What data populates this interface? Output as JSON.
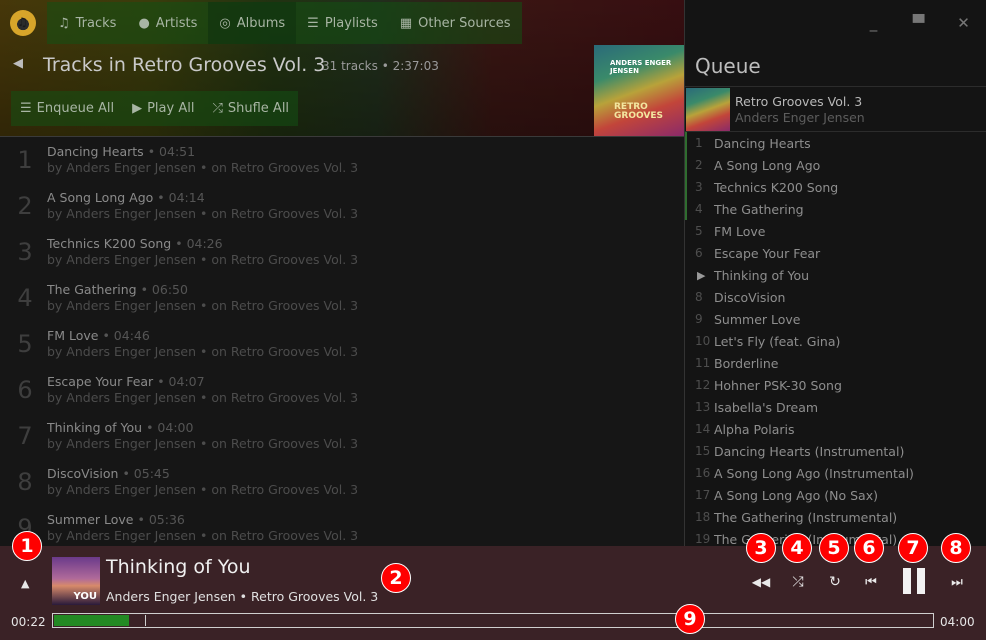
{
  "nav": {
    "tabs": [
      {
        "label": "Tracks",
        "icon": "note-icon"
      },
      {
        "label": "Artists",
        "icon": "person-icon"
      },
      {
        "label": "Albums",
        "icon": "album-icon"
      },
      {
        "label": "Playlists",
        "icon": "list-icon"
      },
      {
        "label": "Other Sources",
        "icon": "grid-icon"
      }
    ],
    "active_tab": "Albums"
  },
  "album": {
    "title": "Tracks in Retro Grooves Vol. 3",
    "meta": "31 tracks • 2:37:03",
    "art_text": "ANDERS ENGER JENSEN",
    "art_logo": "RETRO GROOVES"
  },
  "actions": {
    "enqueue_all": "Enqueue All",
    "play_all": "Play All",
    "shuffle_all": "Shufle All"
  },
  "tracks": [
    {
      "num": "1",
      "title": "Dancing Hearts",
      "duration": "• 04:51",
      "sub": "by Anders Enger Jensen • on Retro Grooves Vol. 3"
    },
    {
      "num": "2",
      "title": "A Song Long Ago",
      "duration": "• 04:14",
      "sub": "by Anders Enger Jensen • on Retro Grooves Vol. 3"
    },
    {
      "num": "3",
      "title": "Technics K200 Song",
      "duration": "• 04:26",
      "sub": "by Anders Enger Jensen • on Retro Grooves Vol. 3"
    },
    {
      "num": "4",
      "title": "The Gathering",
      "duration": "• 06:50",
      "sub": "by Anders Enger Jensen • on Retro Grooves Vol. 3"
    },
    {
      "num": "5",
      "title": "FM Love",
      "duration": "• 04:46",
      "sub": "by Anders Enger Jensen • on Retro Grooves Vol. 3"
    },
    {
      "num": "6",
      "title": "Escape Your Fear",
      "duration": "• 04:07",
      "sub": "by Anders Enger Jensen • on Retro Grooves Vol. 3"
    },
    {
      "num": "7",
      "title": "Thinking of You",
      "duration": "• 04:00",
      "sub": "by Anders Enger Jensen • on Retro Grooves Vol. 3"
    },
    {
      "num": "8",
      "title": "DiscoVision",
      "duration": "• 05:45",
      "sub": "by Anders Enger Jensen • on Retro Grooves Vol. 3"
    },
    {
      "num": "9",
      "title": "Summer Love",
      "duration": "• 05:36",
      "sub": "by Anders Enger Jensen • on Retro Grooves Vol. 3"
    }
  ],
  "window_controls": {
    "minimize": "_",
    "maximize": "▀",
    "close": "✕"
  },
  "queue": {
    "title": "Queue",
    "album_title": "Retro Grooves Vol. 3",
    "album_artist": "Anders Enger Jensen",
    "playing_index": 6,
    "items": [
      {
        "num": "1",
        "title": "Dancing Hearts"
      },
      {
        "num": "2",
        "title": "A Song Long Ago"
      },
      {
        "num": "3",
        "title": "Technics K200 Song"
      },
      {
        "num": "4",
        "title": "The Gathering"
      },
      {
        "num": "5",
        "title": "FM Love"
      },
      {
        "num": "6",
        "title": "Escape Your Fear"
      },
      {
        "num": "▶",
        "title": "Thinking of You"
      },
      {
        "num": "8",
        "title": "DiscoVision"
      },
      {
        "num": "9",
        "title": "Summer Love"
      },
      {
        "num": "10",
        "title": "Let's Fly (feat. Gina)"
      },
      {
        "num": "11",
        "title": "Borderline"
      },
      {
        "num": "12",
        "title": "Hohner PSK-30 Song"
      },
      {
        "num": "13",
        "title": "Isabella's Dream"
      },
      {
        "num": "14",
        "title": "Alpha Polaris"
      },
      {
        "num": "15",
        "title": "Dancing Hearts (Instrumental)"
      },
      {
        "num": "16",
        "title": "A Song Long Ago (Instrumental)"
      },
      {
        "num": "17",
        "title": "A Song Long Ago (No Sax)"
      },
      {
        "num": "18",
        "title": "The Gathering (Instrumental)"
      },
      {
        "num": "19",
        "title": "The Gathering (Instrumental)"
      }
    ]
  },
  "player": {
    "title": "Thinking of You",
    "subtitle": "Anders Enger Jensen • Retro Grooves Vol. 3",
    "art_text": "YOU",
    "elapsed": "00:22",
    "total": "04:00",
    "progress": 0.0855,
    "buffered": 0.1043,
    "accent": "#238a23",
    "bar_bg": "#3a2226"
  },
  "badges": [
    "1",
    "2",
    "3",
    "4",
    "5",
    "6",
    "7",
    "8",
    "9"
  ]
}
